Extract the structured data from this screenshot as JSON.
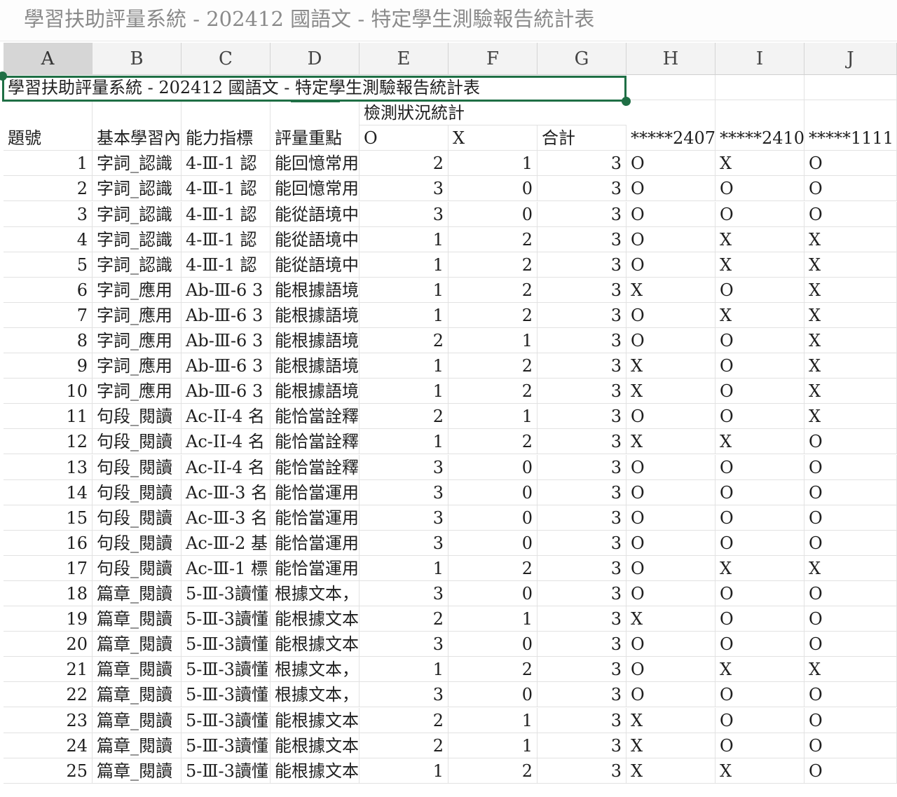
{
  "window": {
    "title": "學習扶助評量系統 - 202412 國語文 - 特定學生測驗報告統計表"
  },
  "colors": {
    "accent": "#1f6f45",
    "header_bg": "#f3f3f3",
    "header_selected_bg": "#d6d6d6"
  },
  "columns": [
    "A",
    "B",
    "C",
    "D",
    "E",
    "F",
    "G",
    "H",
    "I",
    "J"
  ],
  "sheet": {
    "title_cell": "學習扶助評量系統  -  202412  國語文  -  特定學生測驗報告統計表",
    "group_header": "檢測狀況統計",
    "headers": [
      "題號",
      "基本學習內",
      "能力指標",
      "評量重點",
      "O",
      "X",
      "合計",
      "*****2407",
      "*****2410",
      "*****1111"
    ],
    "rows": [
      [
        "1",
        "字詞_認識",
        "4-Ⅲ-1 認",
        "能回憶常用",
        "2",
        "1",
        "3",
        "O",
        "X",
        "O"
      ],
      [
        "2",
        "字詞_認識",
        "4-Ⅲ-1 認",
        "能回憶常用",
        "3",
        "0",
        "3",
        "O",
        "O",
        "O"
      ],
      [
        "3",
        "字詞_認識",
        "4-Ⅲ-1 認",
        "能從語境中",
        "3",
        "0",
        "3",
        "O",
        "O",
        "O"
      ],
      [
        "4",
        "字詞_認識",
        "4-Ⅲ-1 認",
        "能從語境中",
        "1",
        "2",
        "3",
        "O",
        "X",
        "X"
      ],
      [
        "5",
        "字詞_認識",
        "4-Ⅲ-1 認",
        "能從語境中",
        "1",
        "2",
        "3",
        "O",
        "X",
        "X"
      ],
      [
        "6",
        "字詞_應用",
        "Ab-Ⅲ-6 3",
        "能根據語境",
        "1",
        "2",
        "3",
        "X",
        "O",
        "X"
      ],
      [
        "7",
        "字詞_應用",
        "Ab-Ⅲ-6 3",
        "能根據語境",
        "1",
        "2",
        "3",
        "O",
        "X",
        "X"
      ],
      [
        "8",
        "字詞_應用",
        "Ab-Ⅲ-6 3",
        "能根據語境",
        "2",
        "1",
        "3",
        "O",
        "O",
        "X"
      ],
      [
        "9",
        "字詞_應用",
        "Ab-Ⅲ-6 3",
        "能根據語境",
        "1",
        "2",
        "3",
        "X",
        "O",
        "X"
      ],
      [
        "10",
        "字詞_應用",
        "Ab-Ⅲ-6 3",
        "能根據語境",
        "1",
        "2",
        "3",
        "X",
        "O",
        "X"
      ],
      [
        "11",
        "句段_閱讀",
        "Ac-II-4 名",
        "能恰當詮釋",
        "2",
        "1",
        "3",
        "O",
        "O",
        "X"
      ],
      [
        "12",
        "句段_閱讀",
        "Ac-II-4 名",
        "能恰當詮釋",
        "1",
        "2",
        "3",
        "X",
        "X",
        "O"
      ],
      [
        "13",
        "句段_閱讀",
        "Ac-II-4 名",
        "能恰當詮釋",
        "3",
        "0",
        "3",
        "O",
        "O",
        "O"
      ],
      [
        "14",
        "句段_閱讀",
        "Ac-Ⅲ-3 名",
        "能恰當運用",
        "3",
        "0",
        "3",
        "O",
        "O",
        "O"
      ],
      [
        "15",
        "句段_閱讀",
        "Ac-Ⅲ-3 名",
        "能恰當運用",
        "3",
        "0",
        "3",
        "O",
        "O",
        "O"
      ],
      [
        "16",
        "句段_閱讀",
        "Ac-Ⅲ-2 基",
        "能恰當運用",
        "3",
        "0",
        "3",
        "O",
        "O",
        "O"
      ],
      [
        "17",
        "句段_閱讀",
        "Ac-Ⅲ-1 標",
        "能恰當運用",
        "1",
        "2",
        "3",
        "O",
        "X",
        "X"
      ],
      [
        "18",
        "篇章_閱讀",
        "5-Ⅲ-3讀懂",
        "根據文本，",
        "3",
        "0",
        "3",
        "O",
        "O",
        "O"
      ],
      [
        "19",
        "篇章_閱讀",
        "5-Ⅲ-3讀懂",
        "能根據文本",
        "2",
        "1",
        "3",
        "X",
        "O",
        "O"
      ],
      [
        "20",
        "篇章_閱讀",
        "5-Ⅲ-3讀懂",
        "能根據文本",
        "3",
        "0",
        "3",
        "O",
        "O",
        "O"
      ],
      [
        "21",
        "篇章_閱讀",
        "5-Ⅲ-3讀懂",
        "根據文本，",
        "1",
        "2",
        "3",
        "O",
        "X",
        "X"
      ],
      [
        "22",
        "篇章_閱讀",
        "5-Ⅲ-3讀懂",
        "根據文本，",
        "3",
        "0",
        "3",
        "O",
        "O",
        "O"
      ],
      [
        "23",
        "篇章_閱讀",
        "5-Ⅲ-3讀懂",
        "能根據文本",
        "2",
        "1",
        "3",
        "X",
        "O",
        "O"
      ],
      [
        "24",
        "篇章_閱讀",
        "5-Ⅲ-3讀懂",
        "能根據文本",
        "2",
        "1",
        "3",
        "X",
        "O",
        "O"
      ],
      [
        "25",
        "篇章_閱讀",
        "5-Ⅲ-3讀懂",
        "能根據文本",
        "1",
        "2",
        "3",
        "X",
        "X",
        "O"
      ]
    ]
  }
}
